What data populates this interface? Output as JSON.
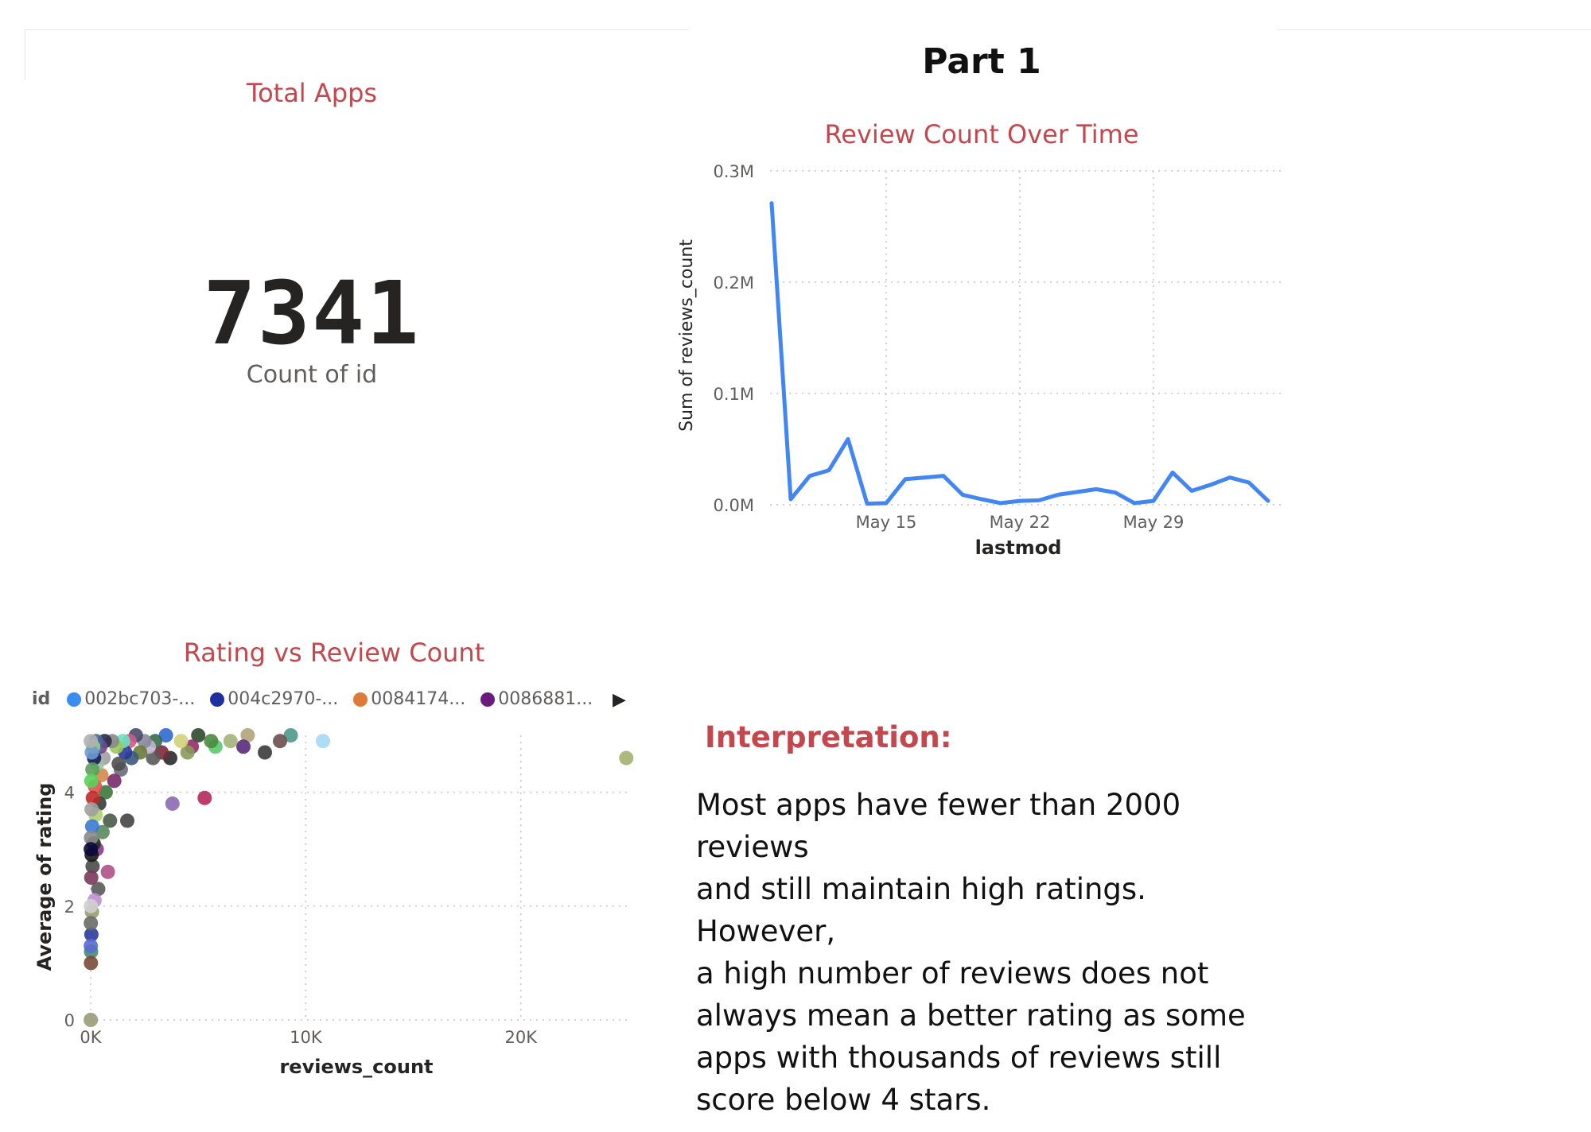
{
  "page": {
    "title": "Part 1"
  },
  "kpi": {
    "title": "Total Apps",
    "value": "7341",
    "label": "Count of id"
  },
  "line_chart": {
    "title": "Review Count Over Time",
    "xlabel": "lastmod",
    "ylabel": "Sum of reviews_count",
    "line_color": "#4286f4"
  },
  "scatter_chart": {
    "title": "Rating vs Review Count",
    "xlabel": "reviews_count",
    "ylabel": "Average of rating",
    "legend": {
      "title": "id",
      "items": [
        {
          "label": "002bc703-...",
          "color": "#3b8cf0"
        },
        {
          "label": "004c2970-...",
          "color": "#1f2f9e"
        },
        {
          "label": "0084174...",
          "color": "#e07a3a"
        },
        {
          "label": "0086881...",
          "color": "#6a1b7c"
        }
      ],
      "more_icon": "caret-right-icon"
    }
  },
  "interpretation": {
    "title": "Interpretation:",
    "lines": [
      "Most apps have fewer than 2000 reviews",
      "and still maintain high ratings. However,",
      "a high number of reviews does not",
      "always mean a better rating as some",
      "apps with thousands of reviews still",
      "score below 4 stars."
    ]
  },
  "chart_data": [
    {
      "type": "line",
      "title": "Review Count Over Time",
      "xlabel": "lastmod",
      "ylabel": "Sum of reviews_count",
      "x": [
        "May 9",
        "May 10",
        "May 11",
        "May 12",
        "May 13",
        "May 14",
        "May 15",
        "May 16",
        "May 17",
        "May 18",
        "May 19",
        "May 20",
        "May 21",
        "May 22",
        "May 23",
        "May 24",
        "May 25",
        "May 26",
        "May 27",
        "May 28",
        "May 29",
        "May 30",
        "May 31",
        "Jun 1",
        "Jun 2",
        "Jun 3"
      ],
      "x_tick_labels": [
        "May 15",
        "May 22",
        "May 29"
      ],
      "series": [
        {
          "values": [
            271000,
            5000,
            26000,
            31000,
            59000,
            1000,
            1500,
            23000,
            24500,
            26000,
            9000,
            5000,
            1500,
            3500,
            4000,
            9000,
            11500,
            14000,
            11000,
            1500,
            3500,
            29000,
            12500,
            18000,
            24500,
            20000,
            3500
          ]
        }
      ],
      "y_tick_labels": [
        "0.0M",
        "0.1M",
        "0.2M",
        "0.3M"
      ],
      "ylim": [
        0,
        300000
      ],
      "grid": true
    },
    {
      "type": "scatter",
      "title": "Rating vs Review Count",
      "xlabel": "reviews_count",
      "ylabel": "Average of rating",
      "x_tick_labels": [
        "0K",
        "10K",
        "20K"
      ],
      "y_tick_labels": [
        "0",
        "2",
        "4"
      ],
      "xlim": [
        0,
        25000
      ],
      "ylim": [
        0,
        5
      ],
      "grid": true,
      "legend_title": "id",
      "legend_position": "top-left",
      "points": [
        {
          "x": 24900,
          "y": 4.6,
          "color": "#a3b06e"
        },
        {
          "x": 10800,
          "y": 4.9,
          "color": "#a5d8f5"
        },
        {
          "x": 9300,
          "y": 5.0,
          "color": "#4d9a8a"
        },
        {
          "x": 8800,
          "y": 4.9,
          "color": "#6b4f4f"
        },
        {
          "x": 8100,
          "y": 4.7,
          "color": "#3b3b3b"
        },
        {
          "x": 7300,
          "y": 5.0,
          "color": "#b2a37a"
        },
        {
          "x": 7100,
          "y": 4.8,
          "color": "#5b2a7a"
        },
        {
          "x": 6500,
          "y": 4.9,
          "color": "#a2b477"
        },
        {
          "x": 5800,
          "y": 4.8,
          "color": "#5ac96b"
        },
        {
          "x": 5600,
          "y": 4.9,
          "color": "#4c8a3e"
        },
        {
          "x": 5300,
          "y": 3.9,
          "color": "#b5285a"
        },
        {
          "x": 5000,
          "y": 5.0,
          "color": "#2c4a2c"
        },
        {
          "x": 4700,
          "y": 4.8,
          "color": "#962b6a"
        },
        {
          "x": 4500,
          "y": 4.7,
          "color": "#889a5a"
        },
        {
          "x": 4200,
          "y": 4.9,
          "color": "#d2d27b"
        },
        {
          "x": 3800,
          "y": 3.8,
          "color": "#8a6ab0"
        },
        {
          "x": 3700,
          "y": 4.6,
          "color": "#2a2a2a"
        },
        {
          "x": 3500,
          "y": 5.0,
          "color": "#2f6ad0"
        },
        {
          "x": 3300,
          "y": 4.7,
          "color": "#7b2a3a"
        },
        {
          "x": 3000,
          "y": 4.9,
          "color": "#3a6a4a"
        },
        {
          "x": 2900,
          "y": 4.6,
          "color": "#5a5a5a"
        },
        {
          "x": 2700,
          "y": 4.8,
          "color": "#c2b5d5"
        },
        {
          "x": 2500,
          "y": 4.9,
          "color": "#8a8a9a"
        },
        {
          "x": 2300,
          "y": 4.7,
          "color": "#6a7a3a"
        },
        {
          "x": 2100,
          "y": 5.0,
          "color": "#4a4a6a"
        },
        {
          "x": 1900,
          "y": 4.6,
          "color": "#3a5a7a"
        },
        {
          "x": 1800,
          "y": 4.9,
          "color": "#d05a8a"
        },
        {
          "x": 1700,
          "y": 3.5,
          "color": "#454545"
        },
        {
          "x": 1600,
          "y": 4.7,
          "color": "#2a3a9a"
        },
        {
          "x": 1500,
          "y": 4.9,
          "color": "#6ae0c0"
        },
        {
          "x": 1400,
          "y": 4.4,
          "color": "#6a6a7a"
        },
        {
          "x": 1300,
          "y": 4.5,
          "color": "#505050"
        },
        {
          "x": 1200,
          "y": 4.8,
          "color": "#9aca5a"
        },
        {
          "x": 1100,
          "y": 4.2,
          "color": "#7a2a6a"
        },
        {
          "x": 1000,
          "y": 4.9,
          "color": "#8a8a8a"
        },
        {
          "x": 900,
          "y": 3.5,
          "color": "#4a5a4a"
        },
        {
          "x": 800,
          "y": 2.6,
          "color": "#b0508a"
        },
        {
          "x": 700,
          "y": 4.0,
          "color": "#3a7a3a"
        },
        {
          "x": 650,
          "y": 4.9,
          "color": "#2a2a4a"
        },
        {
          "x": 600,
          "y": 4.6,
          "color": "#a0a0a0"
        },
        {
          "x": 550,
          "y": 3.3,
          "color": "#5a8a5a"
        },
        {
          "x": 500,
          "y": 4.3,
          "color": "#d08a4a"
        },
        {
          "x": 450,
          "y": 4.8,
          "color": "#6a4a8a"
        },
        {
          "x": 400,
          "y": 3.8,
          "color": "#3a3a3a"
        },
        {
          "x": 350,
          "y": 2.3,
          "color": "#5a5a5a"
        },
        {
          "x": 300,
          "y": 4.5,
          "color": "#a0c0a0"
        },
        {
          "x": 280,
          "y": 3.0,
          "color": "#8a3a8a"
        },
        {
          "x": 250,
          "y": 4.9,
          "color": "#4a6a9a"
        },
        {
          "x": 230,
          "y": 3.6,
          "color": "#b0d070"
        },
        {
          "x": 200,
          "y": 4.1,
          "color": "#e05050"
        },
        {
          "x": 180,
          "y": 2.1,
          "color": "#c090d0"
        },
        {
          "x": 160,
          "y": 4.6,
          "color": "#1a1a5a"
        },
        {
          "x": 140,
          "y": 3.1,
          "color": "#2a2a2a"
        },
        {
          "x": 120,
          "y": 4.8,
          "color": "#90d090"
        },
        {
          "x": 100,
          "y": 3.9,
          "color": "#c02a2a"
        },
        {
          "x": 90,
          "y": 2.7,
          "color": "#4a4a4a"
        },
        {
          "x": 80,
          "y": 4.4,
          "color": "#5aa05a"
        },
        {
          "x": 70,
          "y": 3.4,
          "color": "#3a7ad0"
        },
        {
          "x": 60,
          "y": 1.9,
          "color": "#9a9a6a"
        },
        {
          "x": 50,
          "y": 4.7,
          "color": "#6a9ad0"
        },
        {
          "x": 45,
          "y": 2.9,
          "color": "#1a1a1a"
        },
        {
          "x": 40,
          "y": 3.7,
          "color": "#a0a0a0"
        },
        {
          "x": 35,
          "y": 1.5,
          "color": "#2a3a9a"
        },
        {
          "x": 30,
          "y": 4.2,
          "color": "#5ad05a"
        },
        {
          "x": 25,
          "y": 2.5,
          "color": "#7a3a5a"
        },
        {
          "x": 20,
          "y": 1.2,
          "color": "#4a8a6a"
        },
        {
          "x": 15,
          "y": 3.2,
          "color": "#8a8a8a"
        },
        {
          "x": 10,
          "y": 1.0,
          "color": "#7a4a3a"
        },
        {
          "x": 8,
          "y": 1.7,
          "color": "#6a6a6a"
        },
        {
          "x": 6,
          "y": 2.0,
          "color": "#d0d0d0"
        },
        {
          "x": 5,
          "y": 0.0,
          "color": "#9a9a7a"
        },
        {
          "x": 5,
          "y": 4.9,
          "color": "#b0b0b0"
        },
        {
          "x": 3,
          "y": 1.3,
          "color": "#5a6ad0"
        },
        {
          "x": 2,
          "y": 3.0,
          "color": "#0a0a3a"
        }
      ]
    }
  ]
}
